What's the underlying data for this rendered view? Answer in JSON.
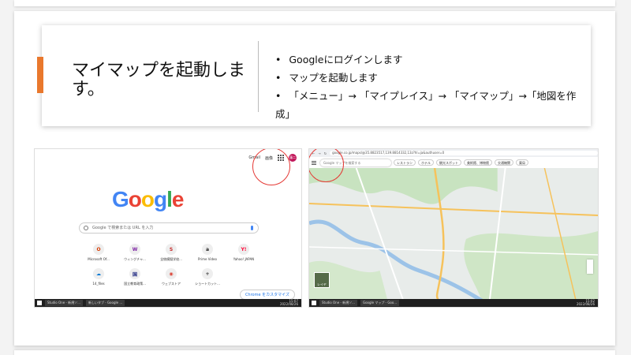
{
  "slide": {
    "title": "マイマップを起動します。",
    "bullets": [
      "Googleにログインします",
      "マップを起動します",
      "「メニュー」→ 「マイプレイス」→ 「マイマップ」→「地図を作成」"
    ],
    "accent_color": "#e9782d"
  },
  "chrome_newtab": {
    "top_links": [
      "Gmail",
      "画像"
    ],
    "avatar": "蓮二",
    "logo": "Google",
    "search_placeholder": "Google で検索または URL を入力",
    "shortcuts": [
      {
        "label": "Microsoft Of...",
        "glyph": "O"
      },
      {
        "label": "ウィングチャ...",
        "glyph": "W"
      },
      {
        "label": "全統模擬学校...",
        "glyph": "S"
      },
      {
        "label": "Prime Video",
        "glyph": "a"
      },
      {
        "label": "Yahoo! JAPAN",
        "glyph": "Y!"
      },
      {
        "label": "14_files",
        "glyph": "☁"
      },
      {
        "label": "国立教育政策...",
        "glyph": "国"
      },
      {
        "label": "ウェブストア",
        "glyph": "◉"
      },
      {
        "label": "ショートカット...",
        "glyph": "+"
      }
    ],
    "customize_label": "Chrome をカスタマイズ",
    "taskbar": {
      "items": [
        "Studio One - 新規ソ...",
        "新しいタブ - Google ..."
      ],
      "time": "15:07",
      "date": "2022/08/26"
    }
  },
  "maps": {
    "url": "google.co.jp/maps/@35.8823517,139.8814332,13z?hl=ja&authuser=0",
    "search_placeholder": "Google マップを検索する",
    "chips": [
      "レストラン",
      "ホテル",
      "観光スポット",
      "美術館、博物館",
      "交通機関",
      "薬局"
    ],
    "layer_label": "レイヤ",
    "taskbar": {
      "items": [
        "Studio One - 新規ソ...",
        "Google マップ - Goo..."
      ],
      "time": "15:02",
      "date": "2022/08/26"
    }
  }
}
